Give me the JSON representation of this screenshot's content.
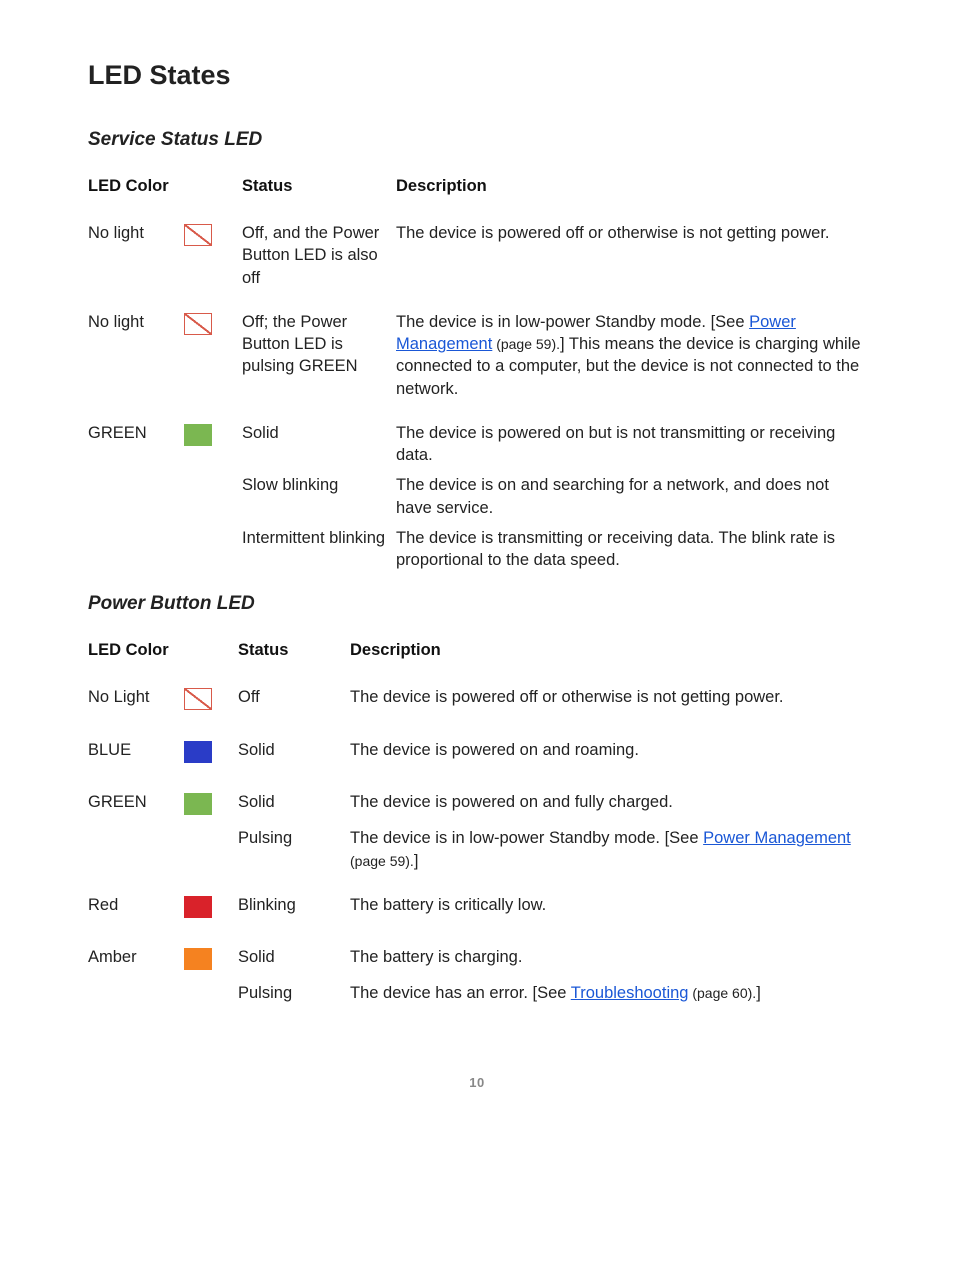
{
  "page_number": "10",
  "title": "LED States",
  "tables": [
    {
      "heading": "Service Status LED",
      "columns": {
        "color": "LED Color",
        "status": "Status",
        "description": "Description"
      },
      "rows": [
        {
          "color": "No light",
          "swatch": "none",
          "entries": [
            {
              "status": "Off, and the Power Button LED is also off",
              "description": "The device is powered off or otherwise is not getting power."
            }
          ]
        },
        {
          "color": "No light",
          "swatch": "none",
          "entries": [
            {
              "status": "Off; the Power Button LED is pulsing GREEN",
              "desc_pre": "The device is in low-power Standby mode. [See ",
              "link_text": "Power Management",
              "page_ref": " (page 59).",
              "desc_post": "] This means the device is charging while connected to a computer, but the device is not connected to the network."
            }
          ]
        },
        {
          "color": "GREEN",
          "swatch": "green",
          "entries": [
            {
              "status": "Solid",
              "description": "The device is powered on but is not transmitting or receiving data."
            },
            {
              "status": "Slow blinking",
              "description": "The device is on and searching for a network, and does not have service."
            },
            {
              "status": "Intermittent blinking",
              "description": "The device is transmitting or receiving data. The blink rate is proportional to the data speed."
            }
          ]
        }
      ]
    },
    {
      "heading": "Power Button LED",
      "columns": {
        "color": "LED Color",
        "status": "Status",
        "description": "Description"
      },
      "rows": [
        {
          "color": "No Light",
          "swatch": "none",
          "entries": [
            {
              "status": "Off",
              "description": "The device is powered off or otherwise is not getting power."
            }
          ]
        },
        {
          "color": "BLUE",
          "swatch": "blue",
          "entries": [
            {
              "status": "Solid",
              "description": "The device is powered on and roaming."
            }
          ]
        },
        {
          "color": "GREEN",
          "swatch": "green",
          "entries": [
            {
              "status": "Solid",
              "description": "The device is powered on and fully charged."
            },
            {
              "status": "Pulsing",
              "desc_pre": "The device is in low-power Standby mode. [See ",
              "link_text": "Power Management",
              "page_ref": " (page 59).",
              "desc_post": "]"
            }
          ]
        },
        {
          "color": "Red",
          "swatch": "red",
          "entries": [
            {
              "status": "Blinking",
              "description": "The battery is critically low."
            }
          ]
        },
        {
          "color": "Amber",
          "swatch": "amber",
          "entries": [
            {
              "status": "Solid",
              "description": "The battery is charging."
            },
            {
              "status": "Pulsing",
              "desc_pre": "The device has an error. [See ",
              "link_text": "Troubleshooting",
              "page_ref": " (page 60).",
              "desc_post": "]"
            }
          ]
        }
      ]
    }
  ]
}
